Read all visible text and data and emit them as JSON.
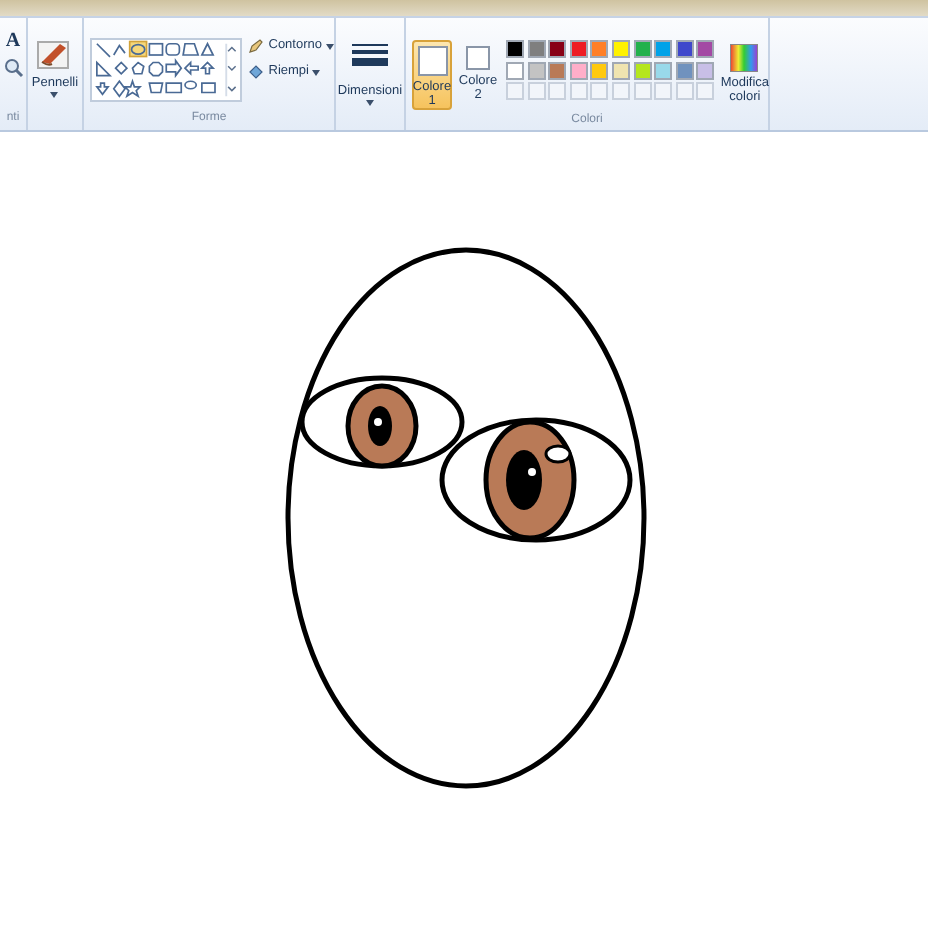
{
  "tools": {
    "text_tool": "A"
  },
  "group_labels": [
    {
      "label": "nti"
    },
    {
      "label": "Forme"
    },
    {
      "label": "Colori"
    }
  ],
  "brushes": {
    "label": "Pennelli"
  },
  "outline": {
    "label": "Contorno"
  },
  "fill": {
    "label": "Riempi"
  },
  "size": {
    "label": "Dimensioni"
  },
  "color_slots": [
    {
      "label": "Colore",
      "number": "1",
      "selected": true
    },
    {
      "label": "Colore",
      "number": "2",
      "selected": false
    }
  ],
  "palette": [
    {
      "color": "#000000"
    },
    {
      "color": "#7f7f7f"
    },
    {
      "color": "#880015"
    },
    {
      "color": "#ed1c24"
    },
    {
      "color": "#ff7f27"
    },
    {
      "color": "#fff200"
    },
    {
      "color": "#22b14c"
    },
    {
      "color": "#00a2e8"
    },
    {
      "color": "#3f48cc"
    },
    {
      "color": "#a349a4"
    },
    {
      "color": "#ffffff"
    },
    {
      "color": "#c3c3c3"
    },
    {
      "color": "#b97a57"
    },
    {
      "color": "#ffaec9"
    },
    {
      "color": "#ffc90e"
    },
    {
      "color": "#efe4b0"
    },
    {
      "color": "#b5e61d"
    },
    {
      "color": "#99d9ea"
    },
    {
      "color": "#7092be"
    },
    {
      "color": "#c8bfe7"
    }
  ],
  "edit_colors": {
    "label": "Modifica colori"
  }
}
